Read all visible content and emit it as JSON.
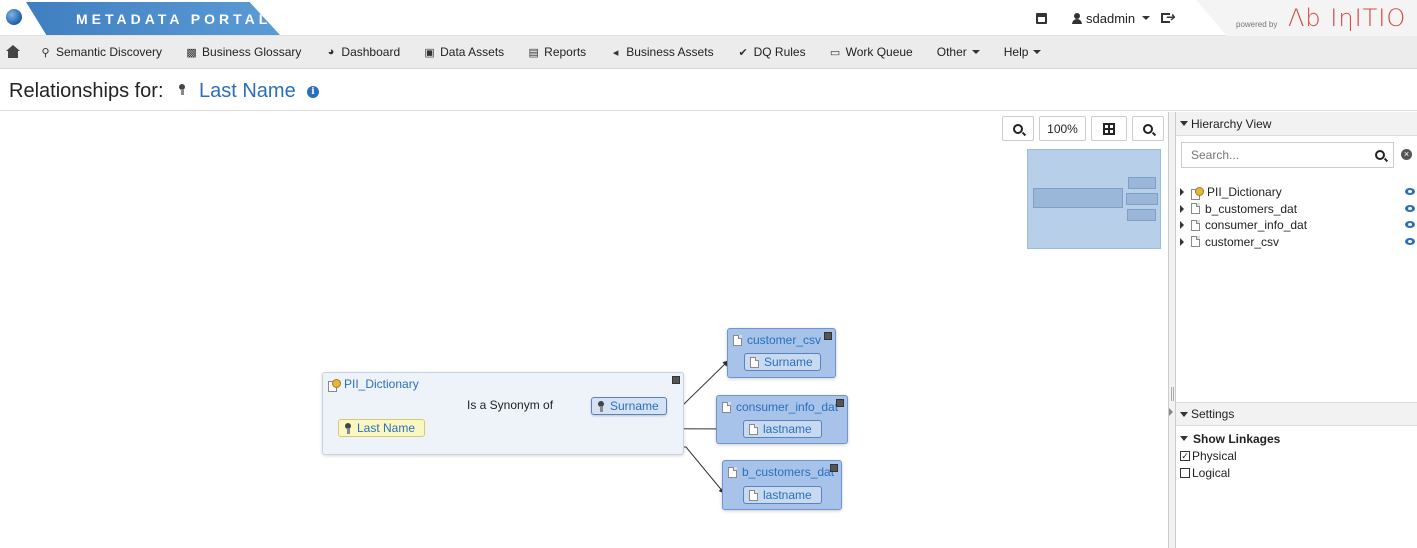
{
  "header": {
    "app_title": "METADATA PORTAL",
    "user": "sdadmin",
    "powered_by": "powered by",
    "vendor_logo": "Ab Initio"
  },
  "nav": {
    "items": [
      {
        "label": "Semantic Discovery",
        "icon": "search-icon"
      },
      {
        "label": "Business Glossary",
        "icon": "book-icon"
      },
      {
        "label": "Dashboard",
        "icon": "dashboard-icon"
      },
      {
        "label": "Data Assets",
        "icon": "folder-icon"
      },
      {
        "label": "Reports",
        "icon": "document-icon"
      },
      {
        "label": "Business Assets",
        "icon": "share-icon"
      },
      {
        "label": "DQ Rules",
        "icon": "check-icon"
      },
      {
        "label": "Work Queue",
        "icon": "inbox-icon"
      },
      {
        "label": "Other",
        "icon": "caret-down-icon"
      },
      {
        "label": "Help",
        "icon": "caret-down-icon"
      }
    ]
  },
  "page": {
    "title_prefix": "Relationships for:",
    "subject": "Last Name"
  },
  "toolbar": {
    "zoom_level": "100%"
  },
  "graph": {
    "dictionary": "PII_Dictionary",
    "source_term": "Last Name",
    "relation_label": "Is a Synonym of",
    "target_term": "Surname",
    "datasets": [
      {
        "name": "customer_csv",
        "field": "Surname"
      },
      {
        "name": "consumer_info_dat",
        "field": "lastname"
      },
      {
        "name": "b_customers_dat",
        "field": "lastname"
      }
    ]
  },
  "hierarchy": {
    "title": "Hierarchy View",
    "search_placeholder": "Search...",
    "nodes": [
      "PII_Dictionary",
      "b_customers_dat",
      "consumer_info_dat",
      "customer_csv"
    ]
  },
  "settings": {
    "title": "Settings",
    "group_label": "Show Linkages",
    "options": [
      {
        "label": "Physical",
        "checked": true
      },
      {
        "label": "Logical",
        "checked": false
      }
    ]
  },
  "colors": {
    "brand_blue": "#3f7fc0",
    "link_blue": "#2a6fba",
    "dataset_fill": "#a8c3ea",
    "term_highlight": "#fbf7c3",
    "logo_red": "#d24a4a"
  }
}
